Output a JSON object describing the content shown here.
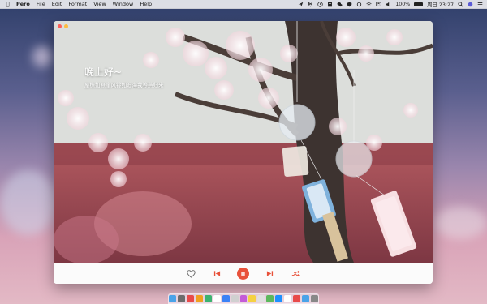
{
  "menubar": {
    "app_name": "Pero",
    "menus": [
      "File",
      "Edit",
      "Format",
      "View",
      "Window",
      "Help"
    ],
    "battery_text": "100%",
    "clock": "周日 23:27"
  },
  "window": {
    "greeting": "晚上好~",
    "subtitle": "屋檐如悬崖风铃如沧海我等燕归来"
  },
  "player": {
    "controls": [
      "heart-icon",
      "previous-icon",
      "pause-icon",
      "next-icon",
      "shuffle-icon"
    ],
    "accent": "#e8513a"
  },
  "dock": {
    "icon_colors": [
      "#4aa3e8",
      "#6c6c6c",
      "#e84a4a",
      "#f0a020",
      "#3cb371",
      "#ffffff",
      "#3b82f6",
      "#d0d0d0",
      "#c45bd8",
      "#f5d142",
      "#e0e0e0",
      "#5cb85c",
      "#1e90ff",
      "#ffffff",
      "#e84a4a",
      "#4aa3e8",
      "#888888"
    ]
  }
}
